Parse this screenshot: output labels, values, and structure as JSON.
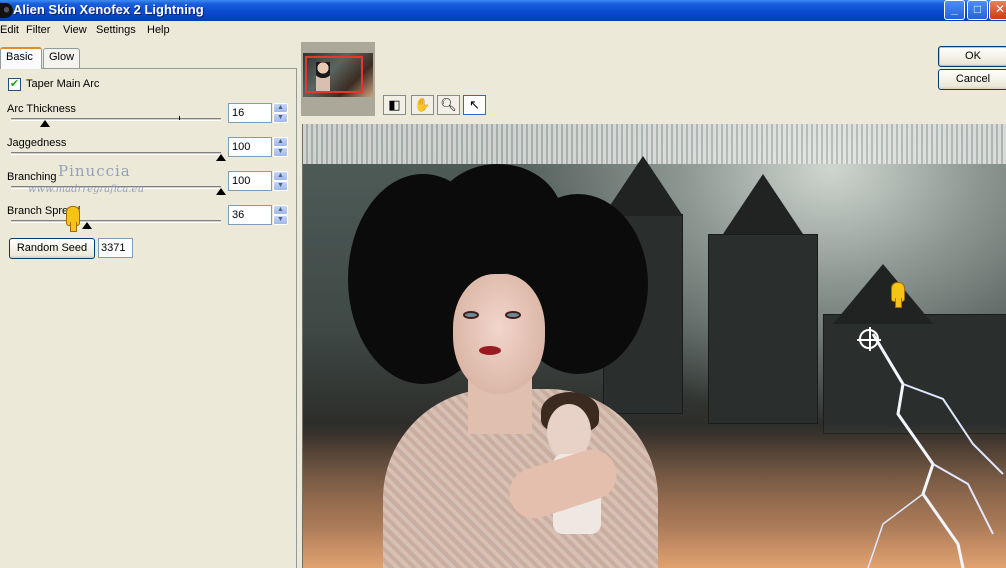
{
  "window": {
    "title": "Alien Skin Xenofex 2 Lightning",
    "controls": {
      "minimize": "_",
      "maximize": "□",
      "close": "✕"
    }
  },
  "menu": {
    "items": [
      "Edit",
      "Filter",
      "View",
      "Settings",
      "Help"
    ]
  },
  "tabs": {
    "basic": "Basic",
    "glow": "Glow"
  },
  "controls": {
    "taper_main_arc": {
      "label": "Taper Main Arc",
      "checked": true
    },
    "arc_thickness": {
      "label": "Arc Thickness",
      "value": "16",
      "fraction": 0.16
    },
    "jaggedness": {
      "label": "Jaggedness",
      "value": "100",
      "fraction": 1.0
    },
    "branching": {
      "label": "Branching",
      "value": "100",
      "fraction": 1.0
    },
    "branch_spread": {
      "label": "Branch Spread",
      "value": "36",
      "fraction": 0.36
    },
    "random_seed": {
      "button_label": "Random Seed",
      "value": "3371"
    }
  },
  "watermark": {
    "name": "Pinuccia",
    "url": "www.madrregrafica.eu"
  },
  "buttons": {
    "ok": "OK",
    "cancel": "Cancel"
  },
  "tools": {
    "preview_toggle": "preview-toggle-icon",
    "hand": "hand-icon",
    "zoom": "zoom-icon",
    "arrow": "arrow-pointer-icon"
  },
  "colors": {
    "titlebar": "#0a4bd0",
    "active_tab_accent": "#e68b2c",
    "thumbnail_frame": "#e8362a"
  }
}
